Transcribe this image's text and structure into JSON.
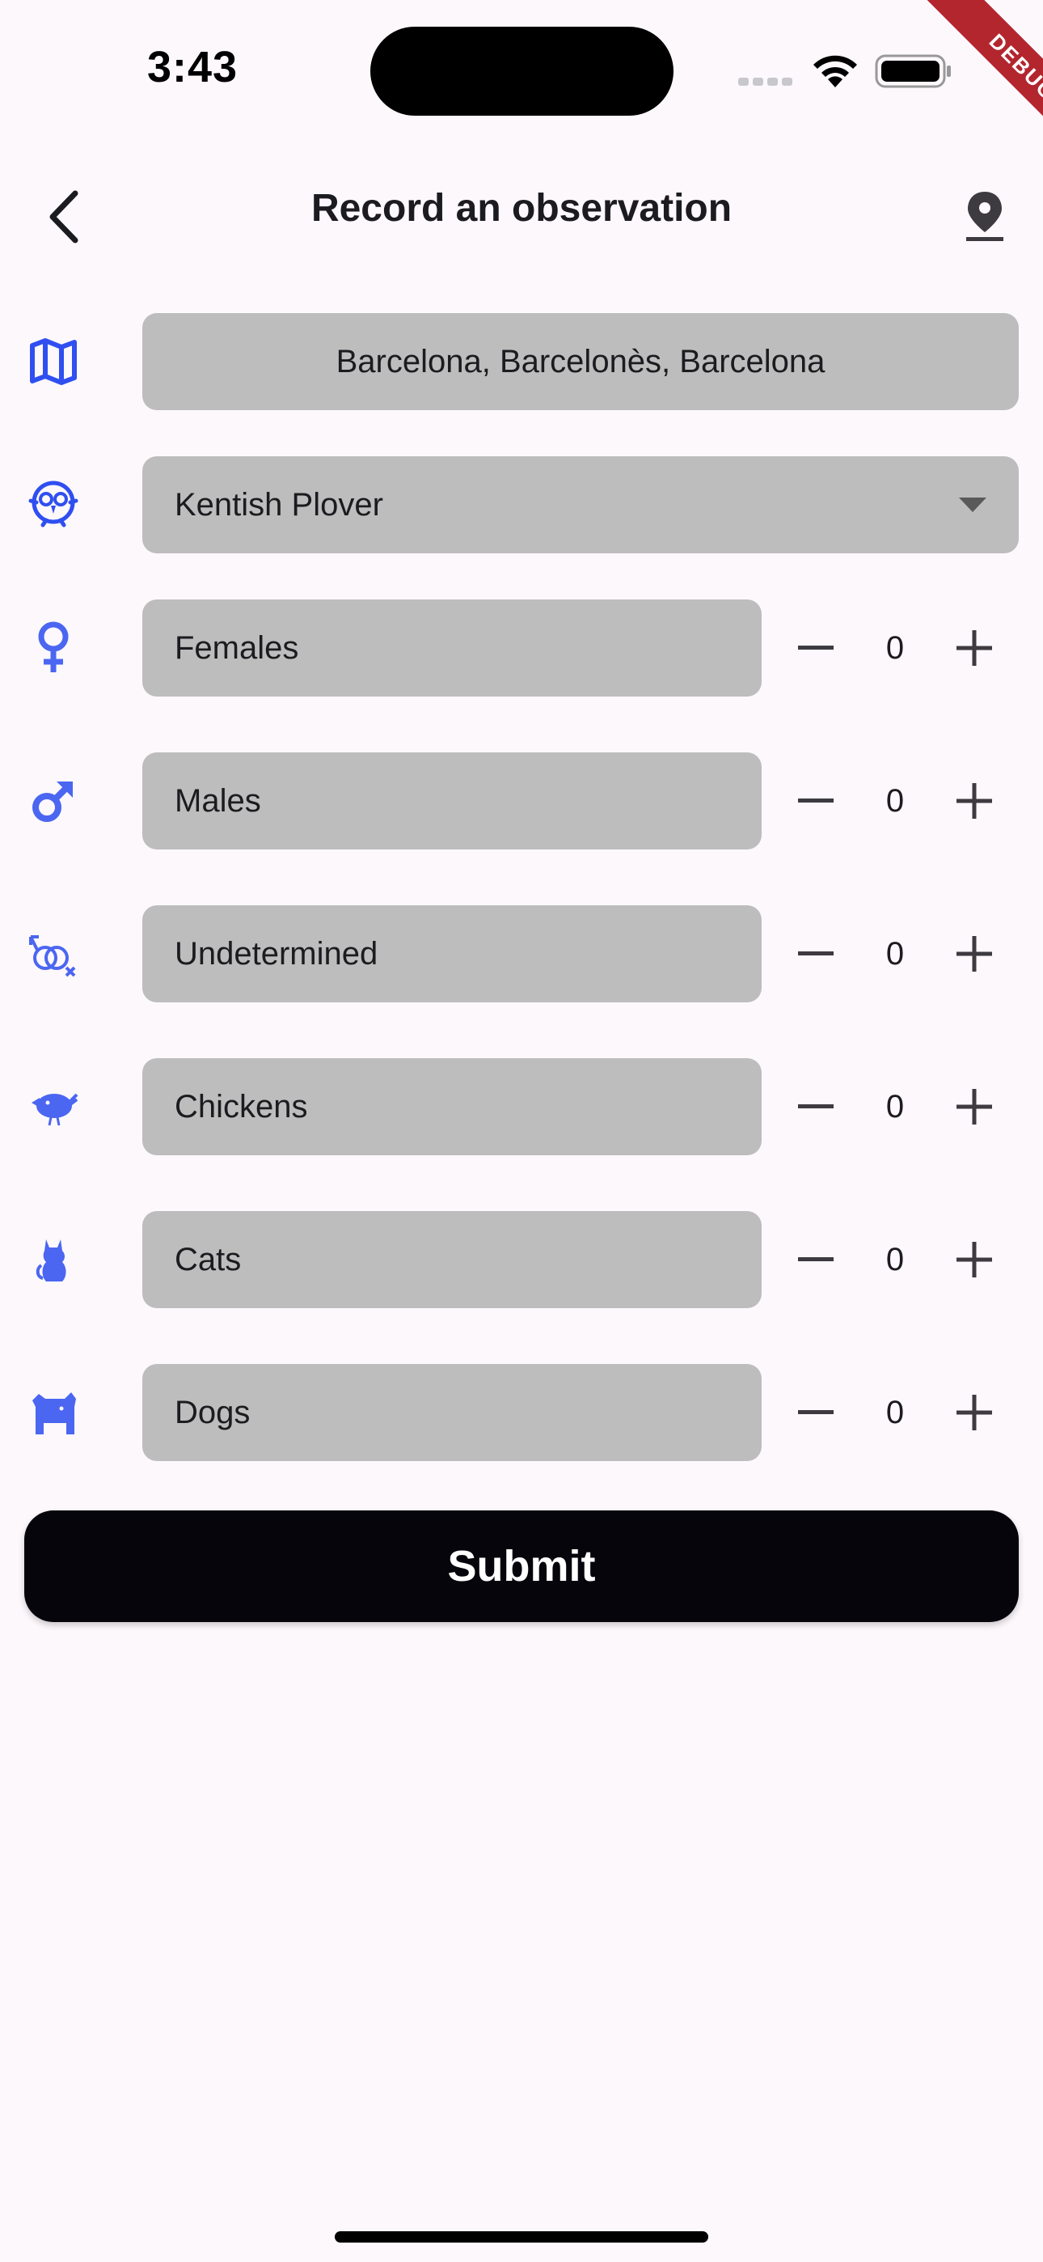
{
  "status_bar": {
    "time": "3:43"
  },
  "debug_banner": "DEBUG",
  "app_bar": {
    "title": "Record an observation",
    "back_icon": "chevron-left-icon",
    "location_icon": "map-pin-icon"
  },
  "location": {
    "value": "Barcelona, Barcelonès, Barcelona",
    "icon": "map-icon"
  },
  "species": {
    "selected": "Kentish Plover",
    "icon": "bird-face-icon"
  },
  "counts": [
    {
      "label": "Females",
      "value": "0",
      "icon": "female-icon"
    },
    {
      "label": "Males",
      "value": "0",
      "icon": "male-icon"
    },
    {
      "label": "Undetermined",
      "value": "0",
      "icon": "gender-undetermined-icon"
    },
    {
      "label": "Chickens",
      "value": "0",
      "icon": "chick-icon"
    },
    {
      "label": "Cats",
      "value": "0",
      "icon": "cat-icon"
    },
    {
      "label": "Dogs",
      "value": "0",
      "icon": "dog-icon"
    }
  ],
  "submit_label": "Submit",
  "colors": {
    "accent": "#2f4ff0",
    "field_bg": "#bdbdbd",
    "button_bg": "#07050c",
    "background": "#fdf8fc"
  }
}
